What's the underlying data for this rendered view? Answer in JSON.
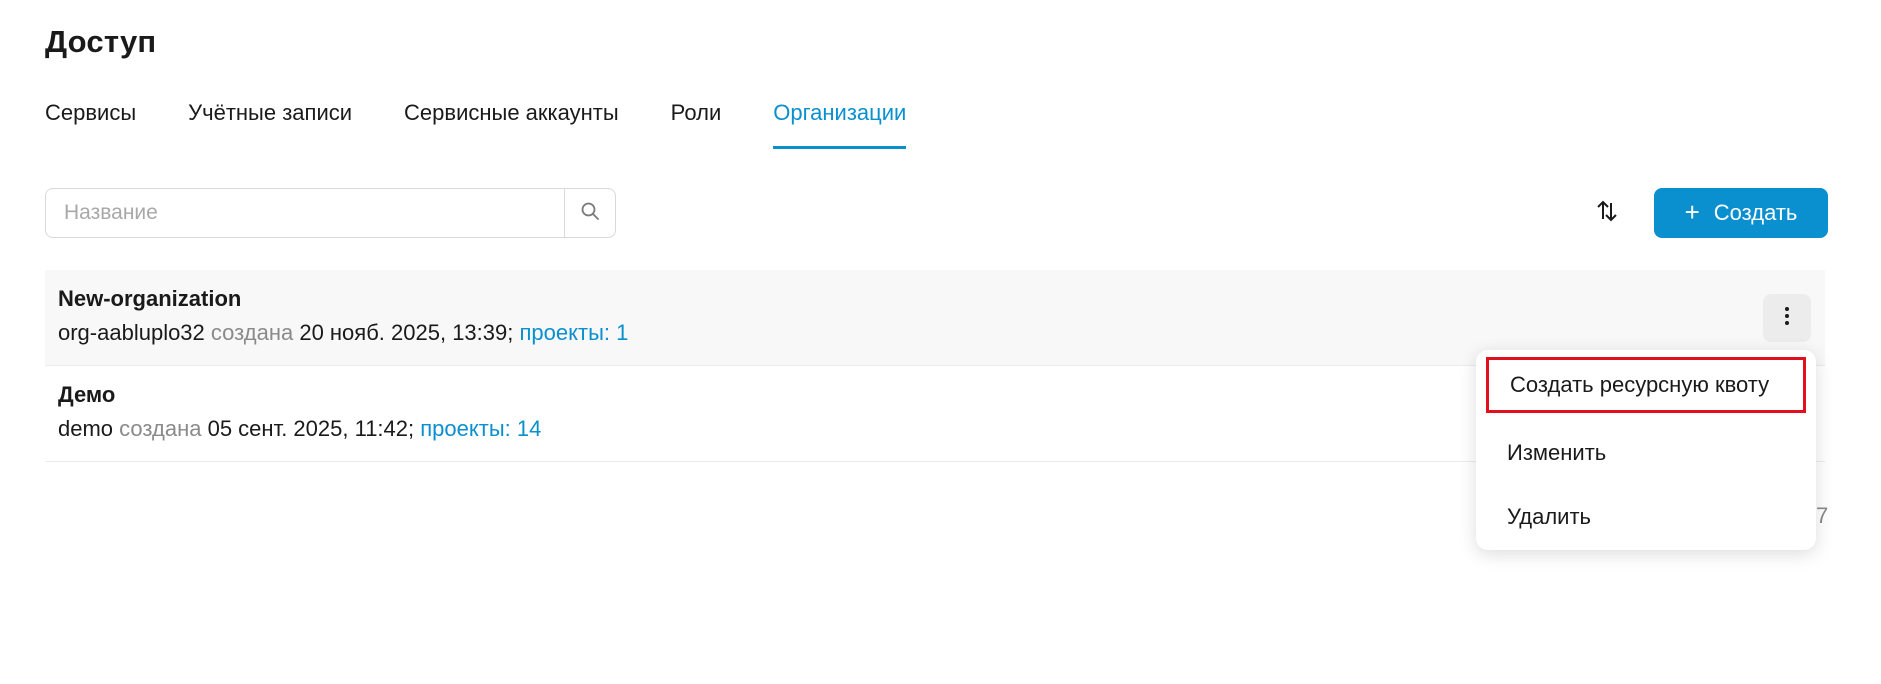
{
  "header": {
    "title": "Доступ"
  },
  "tabs": [
    {
      "label": "Сервисы",
      "active": false
    },
    {
      "label": "Учётные записи",
      "active": false
    },
    {
      "label": "Сервисные аккаунты",
      "active": false
    },
    {
      "label": "Роли",
      "active": false
    },
    {
      "label": "Организации",
      "active": true
    }
  ],
  "toolbar": {
    "search": {
      "placeholder": "Название",
      "value": ""
    },
    "search_icon": "search-icon",
    "sort_icon": "sort-arrows-icon",
    "create_label": "Создать",
    "create_icon": "plus-icon"
  },
  "rows": [
    {
      "name": "New-organization",
      "id": "org-aabluplo32",
      "created_label": "создана",
      "created_at": "20 нояб. 2025, 13:39",
      "separator": ";",
      "projects": "проекты: 1"
    },
    {
      "name": "Демо",
      "id": "demo",
      "created_label": "создана",
      "created_at": "05 сент. 2025, 11:42",
      "separator": ";",
      "projects": "проекты: 14"
    }
  ],
  "context_menu": {
    "items": [
      {
        "label": "Создать ресурсную квоту",
        "highlighted": true
      },
      {
        "label": "Изменить",
        "highlighted": false
      },
      {
        "label": "Удалить",
        "highlighted": false
      }
    ]
  },
  "pagination": {
    "tail": "7"
  },
  "colors": {
    "accent": "#0a8fcf",
    "highlight_border": "#e0101c",
    "muted_text": "#8a8a8a"
  }
}
